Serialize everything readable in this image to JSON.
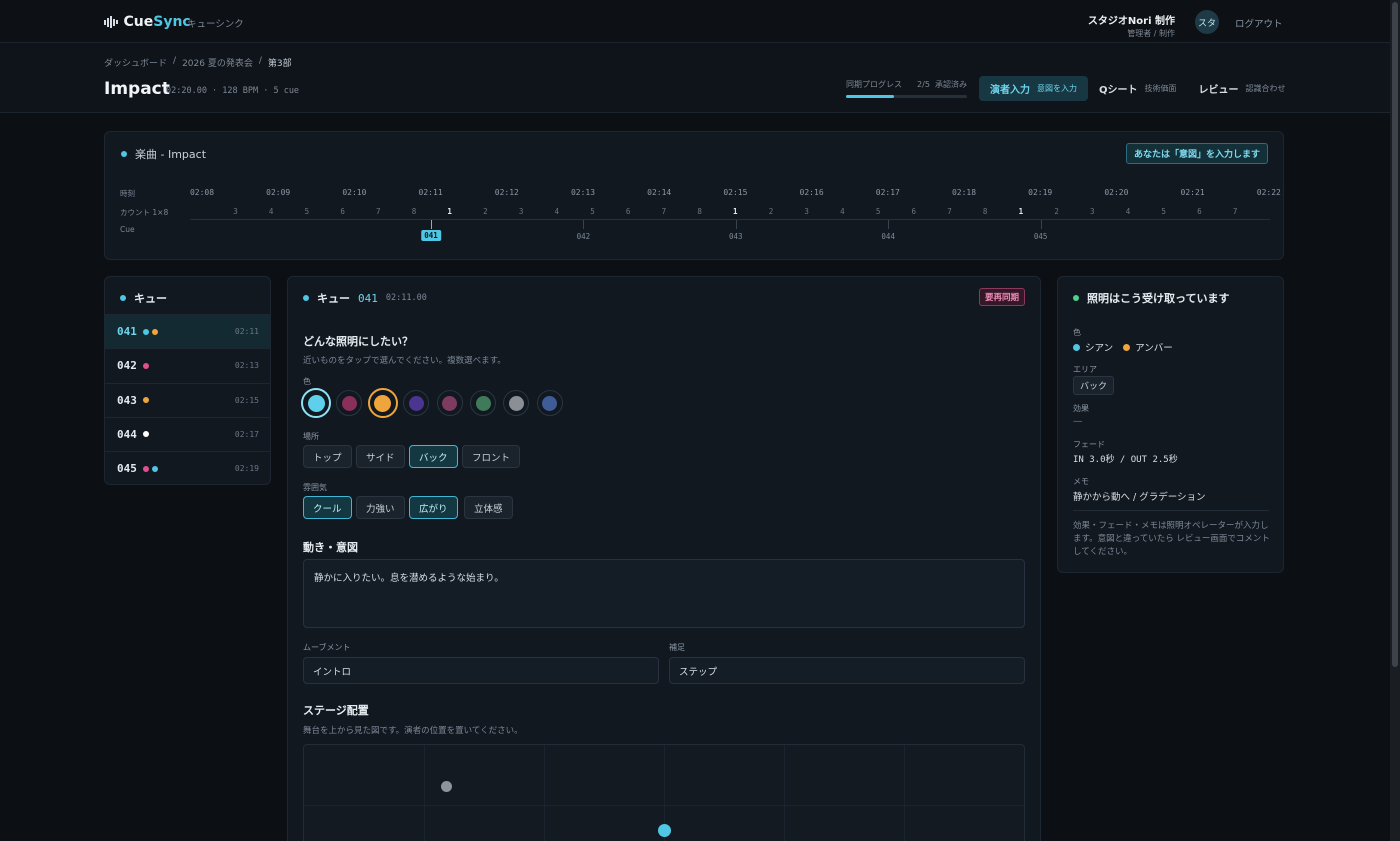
{
  "app": {
    "name_a": "Cue",
    "name_b": "Sync",
    "subtitle": "キューシンク"
  },
  "user": {
    "studio": "スタジオNori 制作",
    "role": "管理者 / 制作",
    "avatar": "スタ",
    "logout": "ログアウト"
  },
  "breadcrumb": [
    "ダッシュボード",
    "2026 夏の発表会",
    "第3部"
  ],
  "breadcrumb_sep": "/",
  "song": {
    "title": "Impact",
    "meta": "02:20.00 · 128 BPM · 5 cue"
  },
  "sync": {
    "label": "同期プログレス",
    "value": "2/5",
    "status": "承認済み",
    "progress": 0.4
  },
  "tabs": [
    {
      "label": "演者入力",
      "sub": "意図を入力",
      "active": true
    },
    {
      "label": "Qシート",
      "sub": "技術価面",
      "active": false
    },
    {
      "label": "レビュー",
      "sub": "認識合わせ",
      "active": false
    }
  ],
  "timeline": {
    "title_prefix": "楽曲 - ",
    "title": "Impact",
    "role_badge": "あなたは「意図」を入力します",
    "row_labels": {
      "time": "時刻",
      "count": "カウント 1×8",
      "cue": "Cue"
    },
    "times": [
      "02:08",
      "02:09",
      "02:10",
      "02:11",
      "02:12",
      "02:13",
      "02:14",
      "02:15",
      "02:16",
      "02:17",
      "02:18",
      "02:19",
      "02:20",
      "02:21",
      "02:22"
    ],
    "counts": [
      "3",
      "4",
      "5",
      "6",
      "7",
      "8",
      "1",
      "2",
      "3",
      "4",
      "5",
      "6",
      "7",
      "8",
      "1",
      "2",
      "3",
      "4",
      "5",
      "6",
      "7",
      "8",
      "1",
      "2",
      "3",
      "4",
      "5",
      "6",
      "7"
    ],
    "cues": [
      {
        "id": "041",
        "active": true
      },
      {
        "id": "042",
        "active": false
      },
      {
        "id": "043",
        "active": false
      },
      {
        "id": "044",
        "active": false
      },
      {
        "id": "045",
        "active": false
      }
    ]
  },
  "cue_list": {
    "title": "キュー",
    "items": [
      {
        "no": "041",
        "time": "02:11",
        "colors": [
          "#4fc6e3",
          "#f0a53c"
        ],
        "selected": true
      },
      {
        "no": "042",
        "time": "02:13",
        "colors": [
          "#e0508f"
        ],
        "selected": false
      },
      {
        "no": "043",
        "time": "02:15",
        "colors": [
          "#f0a53c"
        ],
        "selected": false
      },
      {
        "no": "044",
        "time": "02:17",
        "colors": [
          "#ffffff"
        ],
        "selected": false
      },
      {
        "no": "045",
        "time": "02:19",
        "colors": [
          "#e0508f",
          "#4fc6e3"
        ],
        "selected": false
      }
    ]
  },
  "editor": {
    "title_prefix": "キュー",
    "cue_no": "041",
    "cue_time": "02:11.00",
    "badge": "要再同期",
    "question": "どんな照明にしたい？",
    "hint": "近いものをタップで選んでください。複数選べます。",
    "color_label": "色",
    "colors": [
      {
        "name": "cyan",
        "hex": "#5fd0ec",
        "selected": true,
        "ring": "#8fe2f4"
      },
      {
        "name": "magenta",
        "hex": "#8a2e5a",
        "selected": false
      },
      {
        "name": "amber",
        "hex": "#f0a53c",
        "selected": true,
        "ring": "#f0a53c"
      },
      {
        "name": "purple",
        "hex": "#4a3590",
        "selected": false
      },
      {
        "name": "rose",
        "hex": "#7d3b62",
        "selected": false
      },
      {
        "name": "green",
        "hex": "#3f7a5a",
        "selected": false
      },
      {
        "name": "gray",
        "hex": "#8a8f96",
        "selected": false
      },
      {
        "name": "blue",
        "hex": "#3e5c98",
        "selected": false
      }
    ],
    "area_label": "場所",
    "areas": [
      {
        "label": "トップ",
        "selected": false
      },
      {
        "label": "サイド",
        "selected": false
      },
      {
        "label": "バック",
        "selected": true
      },
      {
        "label": "フロント",
        "selected": false
      }
    ],
    "mood_label": "雰囲気",
    "moods": [
      {
        "label": "クール",
        "selected": true
      },
      {
        "label": "力強い",
        "selected": false
      },
      {
        "label": "広がり",
        "selected": true
      },
      {
        "label": "立体感",
        "selected": false
      }
    ],
    "intent_title": "動き・意図",
    "intent_text": "静かに入りたい。息を潜めるような始まり。",
    "movement_label": "ムーブメント",
    "movement_value": "イントロ",
    "extra_label": "補足",
    "extra_value": "ステップ",
    "stage_title": "ステージ配置",
    "stage_hint": "舞台を上から見た図です。演者の位置を置いてください。"
  },
  "receive": {
    "title": "照明はこう受け取っています",
    "color_label": "色",
    "colors": [
      {
        "label": "シアン",
        "hex": "#4fc6e3"
      },
      {
        "label": "アンバー",
        "hex": "#f0a53c"
      }
    ],
    "area_label": "エリア",
    "area_value": "バック",
    "effect_label": "効果",
    "effect_value": "—",
    "fade_label": "フェード",
    "fade_value": "IN 3.0秒 / OUT 2.5秒",
    "memo_label": "メモ",
    "memo_value": "静かから動へ / グラデーション",
    "note": "効果・フェード・メモは照明オペレーターが入力します。意図と違っていたら レビュー画面でコメントしてください。"
  }
}
